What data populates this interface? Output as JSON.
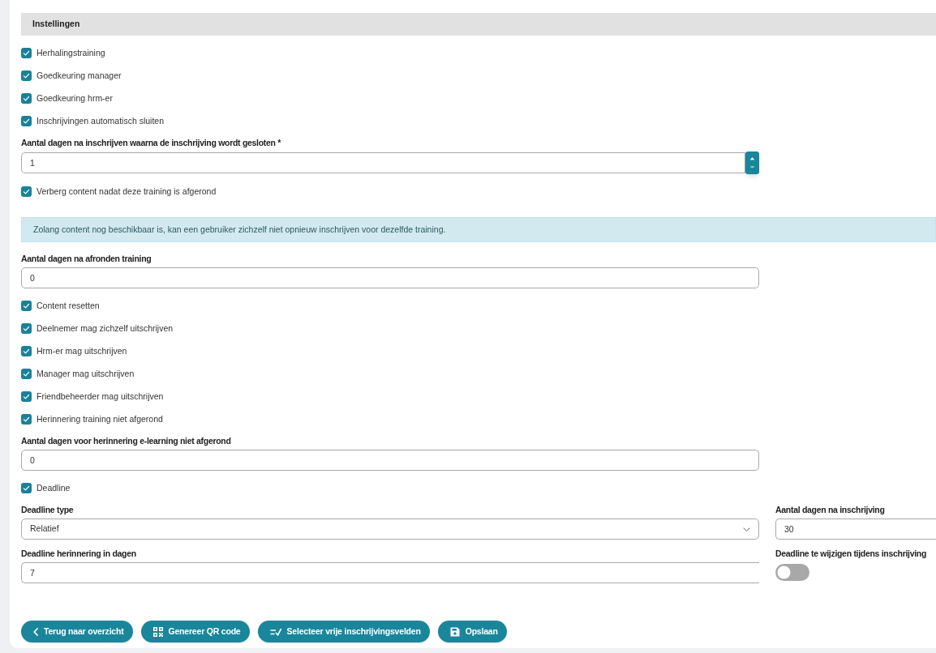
{
  "settings": {
    "title": "Instellingen",
    "items": [
      {
        "kind": "checkbox",
        "label": "Herhalingstraining",
        "checked": true
      },
      {
        "kind": "checkbox",
        "label": "Goedkeuring manager",
        "checked": true
      },
      {
        "kind": "checkbox",
        "label": "Goedkeuring hrm-er",
        "checked": true
      },
      {
        "kind": "checkbox",
        "label": "Inschrijvingen automatisch sluiten",
        "checked": true
      },
      {
        "kind": "number",
        "label": "Aantal dagen na inschrijven waarna de inschrijving wordt gesloten *",
        "value": "1"
      },
      {
        "kind": "checkbox",
        "label": "Verberg content nadat deze training is afgerond",
        "checked": true
      },
      {
        "kind": "alert",
        "text": "Zolang content nog beschikbaar is, kan een gebruiker zichzelf niet opnieuw inschrijven voor dezelfde training."
      },
      {
        "kind": "input",
        "label": "Aantal dagen na afronden training",
        "value": "0"
      },
      {
        "kind": "checkbox",
        "label": "Content resetten",
        "checked": true
      },
      {
        "kind": "checkbox",
        "label": "Deelnemer mag zichzelf uitschrijven",
        "checked": true
      },
      {
        "kind": "checkbox",
        "label": "Hrm-er mag uitschrijven",
        "checked": true
      },
      {
        "kind": "checkbox",
        "label": "Manager mag uitschrijven",
        "checked": true
      },
      {
        "kind": "checkbox",
        "label": "Friendbeheerder mag uitschrijven",
        "checked": true
      },
      {
        "kind": "checkbox",
        "label": "Herinnering training niet afgerond",
        "checked": true
      },
      {
        "kind": "input",
        "label": "Aantal dagen voor herinnering e-learning niet afgerond",
        "value": "0"
      },
      {
        "kind": "checkbox",
        "label": "Deadline",
        "checked": true
      },
      {
        "kind": "grid",
        "fields": [
          {
            "kind": "select",
            "label": "Deadline type",
            "value": "Relatief"
          },
          {
            "kind": "input",
            "label": "Aantal dagen na inschrijving",
            "value": "30"
          },
          {
            "kind": "input",
            "label": "Deadline herinnering in dagen",
            "value": "7"
          },
          {
            "kind": "toggle",
            "label": "Deadline te wijzigen tijdens inschrijving",
            "on": false
          }
        ]
      }
    ]
  },
  "buttons": [
    {
      "kind": "back",
      "label": "Terug naar overzicht"
    },
    {
      "kind": "qr",
      "label": "Genereer QR code"
    },
    {
      "kind": "fields",
      "label": "Selecteer vrije inschrijvingsvelden"
    },
    {
      "kind": "save",
      "label": "Opslaan"
    }
  ]
}
